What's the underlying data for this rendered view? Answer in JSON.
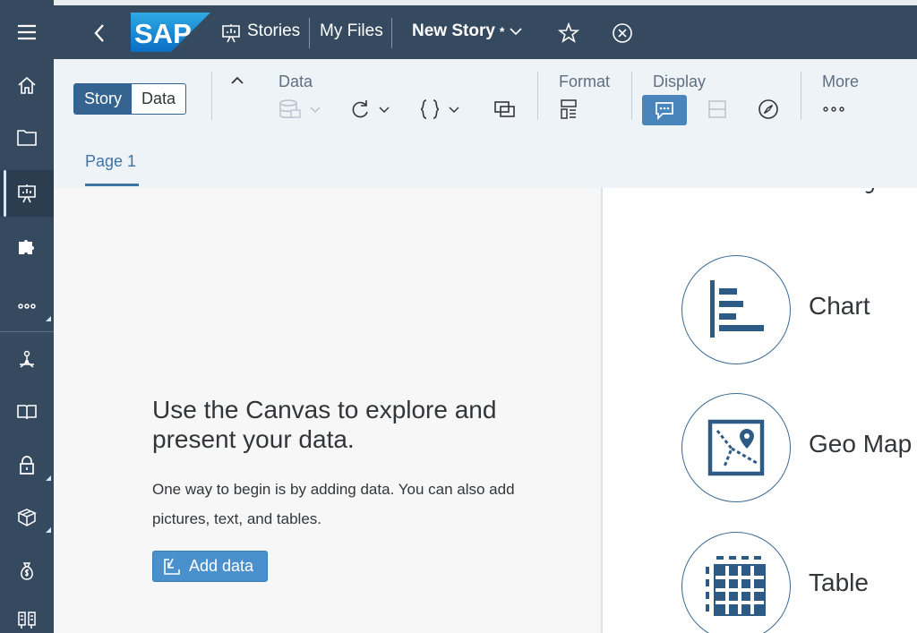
{
  "sidebar": {
    "items": [
      {
        "icon": "home-icon"
      },
      {
        "icon": "folder-icon"
      },
      {
        "icon": "stories-icon",
        "active": true
      },
      {
        "icon": "puzzle-icon"
      },
      {
        "icon": "more-icon"
      },
      {
        "icon": "network-icon"
      },
      {
        "icon": "book-icon"
      },
      {
        "icon": "lock-icon"
      },
      {
        "icon": "box-icon"
      },
      {
        "icon": "money-bag-icon"
      },
      {
        "icon": "columns-icon"
      }
    ]
  },
  "shellbar": {
    "logo_text": "SAP",
    "breadcrumb_stories": "Stories",
    "breadcrumb_files": "My Files",
    "story_title": "New Story",
    "unsaved_marker": "*"
  },
  "toolbar": {
    "segment": {
      "story_label": "Story",
      "data_label": "Data",
      "selected": "Story"
    },
    "groups": {
      "data": "Data",
      "format": "Format",
      "display": "Display",
      "more": "More"
    }
  },
  "tabs": {
    "page1": "Page 1"
  },
  "canvas": {
    "title": "Use the Canvas to explore and present your data.",
    "body": "One way to begin is by adding data. You can also add pictures, text, and tables.",
    "add_data_label": "Add data"
  },
  "insert_panel": {
    "items": [
      {
        "label": "Chart",
        "icon": "chart-icon"
      },
      {
        "label": "Geo Map",
        "icon": "geo-map-icon"
      },
      {
        "label": "Table",
        "icon": "table-icon"
      }
    ]
  },
  "colors": {
    "shell": "#354a5f",
    "accent": "#35638f",
    "button": "#4a90cd",
    "toolbar_bg": "#eef3f8"
  }
}
